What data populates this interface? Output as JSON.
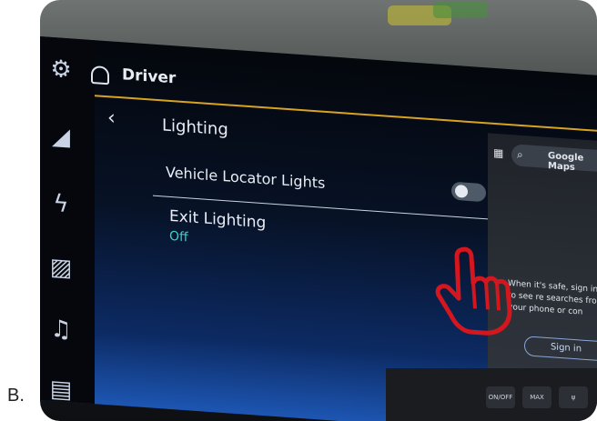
{
  "option_letter": "B.",
  "header": {
    "title": "Driver"
  },
  "page": {
    "back_glyph": "‹",
    "section_title": "Lighting"
  },
  "settings": {
    "vehicle_locator": {
      "label": "Vehicle Locator Lights",
      "toggle_state": "off"
    },
    "exit_lighting": {
      "label": "Exit Lighting",
      "value": "Off"
    }
  },
  "maps_panel": {
    "title": "Google Maps",
    "message": "When it's safe, sign in to see re searches from your phone or con",
    "sign_in_label": "Sign in"
  },
  "hardware_buttons": [
    "ON/OFF",
    "MAX",
    "ψ"
  ],
  "icons": [
    "settings-gear-icon",
    "car-icon",
    "lightning-icon",
    "display-icon",
    "music-note-icon",
    "seat-icon",
    "bell-icon",
    "back-chevron-icon",
    "map-icon",
    "search-icon",
    "home-icon",
    "location-pin-icon",
    "hand-pointer-icon"
  ],
  "colors": {
    "accent_line": "#d9a322",
    "value_teal": "#34d6c9",
    "hand_red": "#d4161f"
  }
}
